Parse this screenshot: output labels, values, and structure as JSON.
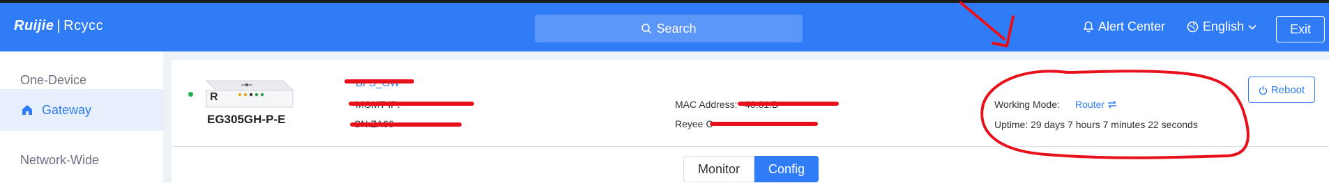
{
  "header": {
    "logo_brand": "Ruijie",
    "logo_sep": "|",
    "logo_product": "Rcycc",
    "search_label": "Search",
    "alert_label": "Alert Center",
    "language_label": "English",
    "exit_label": "Exit"
  },
  "sidebar": {
    "section_one": "One-Device",
    "active_item": "Gateway",
    "section_two": "Network-Wide"
  },
  "device": {
    "badge": "R",
    "model": "EG305GH-P-E",
    "name_fragment": "BFS_GW",
    "mgmt_label": "MGMT IP:",
    "sn_label": "SN:ZA66",
    "mac_label": "MAC Address:",
    "mac_fragment": "48:81:D",
    "cloud_label": "Reyee C",
    "working_mode_label": "Working Mode:",
    "working_mode_value": "Router",
    "uptime_text": "Uptime: 29 days 7 hours 7 minutes 22 seconds",
    "reboot_label": "Reboot"
  },
  "tabs": {
    "monitor_label": "Monitor",
    "config_label": "Config"
  },
  "colors": {
    "primary": "#2f7cf6",
    "annotation": "#e8101a",
    "online": "#22b14c"
  }
}
